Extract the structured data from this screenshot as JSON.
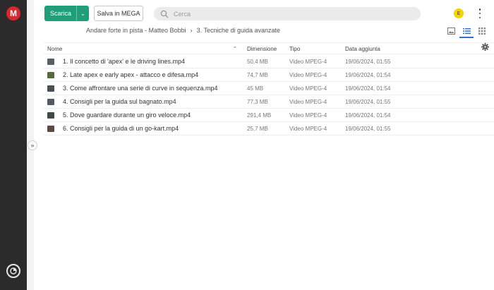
{
  "header": {
    "download_label": "Scarica",
    "save_label": "Salva in MEGA",
    "search_placeholder": "Cerca",
    "avatar_initial": "E"
  },
  "breadcrumb": {
    "parent": "Andare forte in pista - Matteo Bobbi",
    "separator": "›",
    "current": "3. Tecniche di guida avanzate"
  },
  "table": {
    "columns": {
      "name": "Nome",
      "size": "Dimensione",
      "type": "Tipo",
      "date": "Data aggiunta"
    },
    "rows": [
      {
        "name": "1. Il concetto di 'apex' e le driving lines.mp4",
        "size": "50,4 MB",
        "type": "Video MPEG-4",
        "date": "19/06/2024, 01:55",
        "thumb_color": "#5a5f63"
      },
      {
        "name": "2. Late apex e early apex - attacco e difesa.mp4",
        "size": "74,7 MB",
        "type": "Video MPEG-4",
        "date": "19/06/2024, 01:54",
        "thumb_color": "#556b3a"
      },
      {
        "name": "3. Come affrontare una serie di curve in sequenza.mp4",
        "size": "45 MB",
        "type": "Video MPEG-4",
        "date": "19/06/2024, 01:54",
        "thumb_color": "#4a4f55"
      },
      {
        "name": "4. Consigli per la guida sul bagnato.mp4",
        "size": "77,3 MB",
        "type": "Video MPEG-4",
        "date": "19/06/2024, 01:55",
        "thumb_color": "#505a60"
      },
      {
        "name": "5. Dove guardare durante un giro veloce.mp4",
        "size": "291,4 MB",
        "type": "Video MPEG-4",
        "date": "19/06/2024, 01:54",
        "thumb_color": "#3f4a4a"
      },
      {
        "name": "6. Consigli per la guida di un go-kart.mp4",
        "size": "25,7 MB",
        "type": "Video MPEG-4",
        "date": "19/06/2024, 01:55",
        "thumb_color": "#5c4a45"
      }
    ]
  },
  "colors": {
    "primary": "#1f9e78",
    "brand_red": "#d9272e",
    "rail": "#2b2b2b",
    "active_view": "#2f6fd6"
  },
  "icons": {
    "logo": "mega-logo-icon",
    "search": "search-icon",
    "menu": "kebab-menu-icon",
    "thumbnail_view": "thumbnail-view-icon",
    "list_view": "list-view-icon",
    "grid_view": "grid-view-icon",
    "settings": "gear-icon",
    "expand": "chevron-double-right-icon",
    "sort": "sort-ascending-icon"
  }
}
